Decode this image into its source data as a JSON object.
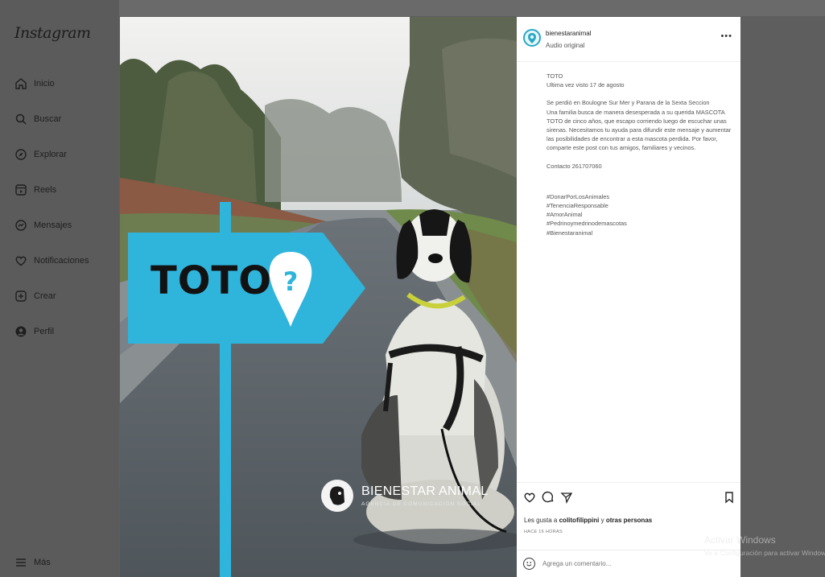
{
  "sidebar": {
    "logo": "Instagram",
    "items": [
      {
        "label": "Inicio",
        "icon": "home-icon"
      },
      {
        "label": "Buscar",
        "icon": "search-icon"
      },
      {
        "label": "Explorar",
        "icon": "compass-icon"
      },
      {
        "label": "Reels",
        "icon": "reels-icon"
      },
      {
        "label": "Mensajes",
        "icon": "messenger-icon"
      },
      {
        "label": "Notificaciones",
        "icon": "heart-icon"
      },
      {
        "label": "Crear",
        "icon": "plus-square-icon"
      },
      {
        "label": "Perfil",
        "icon": "profile-icon"
      }
    ],
    "more": "Más"
  },
  "media": {
    "sign_text": "TOTO",
    "brand_name": "BIENESTAR ANIMAL",
    "brand_subtitle": "AGENCIA DE COMUNICACIÓN SOCIAL",
    "sign_color": "#2fb5dc"
  },
  "post": {
    "username": "bienestaranimal",
    "audio": "Audio original",
    "caption": {
      "title": "TOTO",
      "last_seen": "Ultima vez visto 17 de agosto",
      "body": [
        "Se perdió en Boulogne Sur Mer y Parana de la Sexta Seccion",
        "Una familia busca de manera desesperada a su querida MASCOTA",
        "TOTO de cinco años, que escapo corriendo luego de escuchar unas",
        "sirenas. Necesitamos tu ayuda para difundir este mensaje y aumentar",
        "las posibilidades de encontrar a esta mascota perdida. Por favor,",
        "comparte este post con tus amigos, familiares y vecinos."
      ],
      "contact": "Contacto 261707060",
      "hashtags": [
        "#DonarPorLosAnimales",
        "#TenenciaResponsable",
        "#AmorAnimal",
        "#Pedrinoymedrinodemascotas",
        "#Bienestaranimal"
      ]
    },
    "likes_prefix": "Les gusta a",
    "likes_user": "colitofilippini",
    "likes_and": "y",
    "likes_others": "otras personas",
    "time": "HACE 16 HORAS",
    "comment_placeholder": "Agrega un comentario..."
  },
  "watermark": {
    "line1": "Activar Windows",
    "line2": "Ve a Configuración para activar Windows."
  }
}
